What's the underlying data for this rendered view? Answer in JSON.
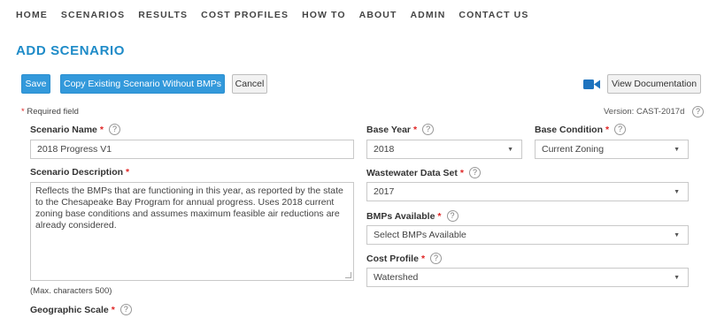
{
  "nav": {
    "items": [
      "HOME",
      "SCENARIOS",
      "RESULTS",
      "COST PROFILES",
      "HOW TO",
      "ABOUT",
      "ADMIN",
      "CONTACT US"
    ]
  },
  "page_title": "ADD SCENARIO",
  "toolbar": {
    "save_label": "Save",
    "copy_label": "Copy Existing Scenario Without BMPs",
    "cancel_label": "Cancel",
    "doc_label": "View Documentation",
    "camera_icon": "video-camera-icon"
  },
  "required_note": "Required field",
  "version": "Version: CAST-2017d",
  "form": {
    "scenario_name": {
      "label": "Scenario Name",
      "value": "2018 Progress V1"
    },
    "scenario_description": {
      "label": "Scenario Description",
      "value": "Reflects the BMPs that are functioning in this year, as reported by the state to the Chesapeake Bay Program for annual progress. Uses 2018 current zoning base conditions and assumes maximum feasible air reductions are already considered.",
      "max_chars": "(Max. characters 500)"
    },
    "geographic_scale": {
      "label": "Geographic Scale"
    },
    "base_year": {
      "label": "Base Year",
      "value": "2018"
    },
    "base_condition": {
      "label": "Base Condition",
      "value": "Current Zoning"
    },
    "wastewater": {
      "label": "Wastewater Data Set",
      "value": "2017"
    },
    "bmps_available": {
      "label": "BMPs Available",
      "value": "Select BMPs Available"
    },
    "cost_profile": {
      "label": "Cost Profile",
      "value": "Watershed"
    }
  },
  "colors": {
    "accent": "#1e8bc8",
    "button": "#3399db",
    "required": "#e02424"
  }
}
